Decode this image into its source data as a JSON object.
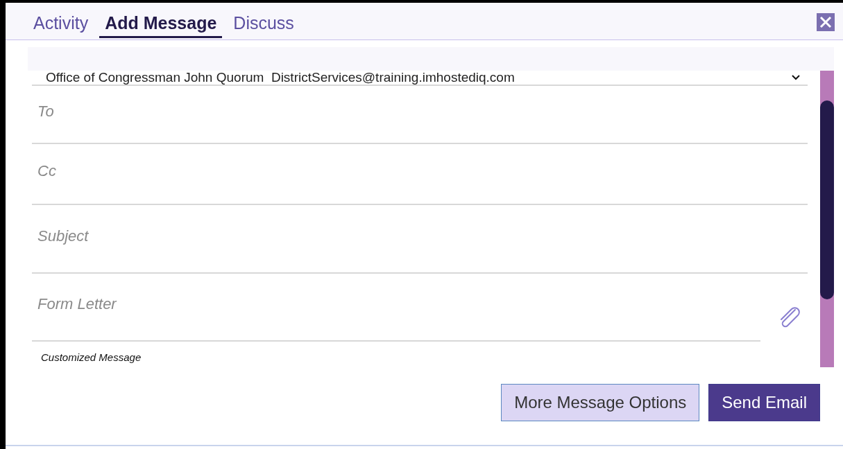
{
  "tabs": [
    {
      "label": "Activity",
      "selected": false
    },
    {
      "label": "Add Message",
      "selected": true
    },
    {
      "label": "Discuss",
      "selected": false
    }
  ],
  "from": {
    "value": "Office of Congressman John Quorum  DistrictServices@training.imhostediq.com"
  },
  "fields": [
    {
      "placeholder": "To",
      "kind": "text"
    },
    {
      "placeholder": "Cc",
      "kind": "text"
    },
    {
      "placeholder": "Subject",
      "kind": "text"
    },
    {
      "placeholder": "Form Letter",
      "kind": "attach"
    }
  ],
  "message_label": "Customized Message",
  "buttons": [
    {
      "label": "More Message Options",
      "kind": "secondary"
    },
    {
      "label": "Send Email",
      "kind": "primary"
    }
  ]
}
